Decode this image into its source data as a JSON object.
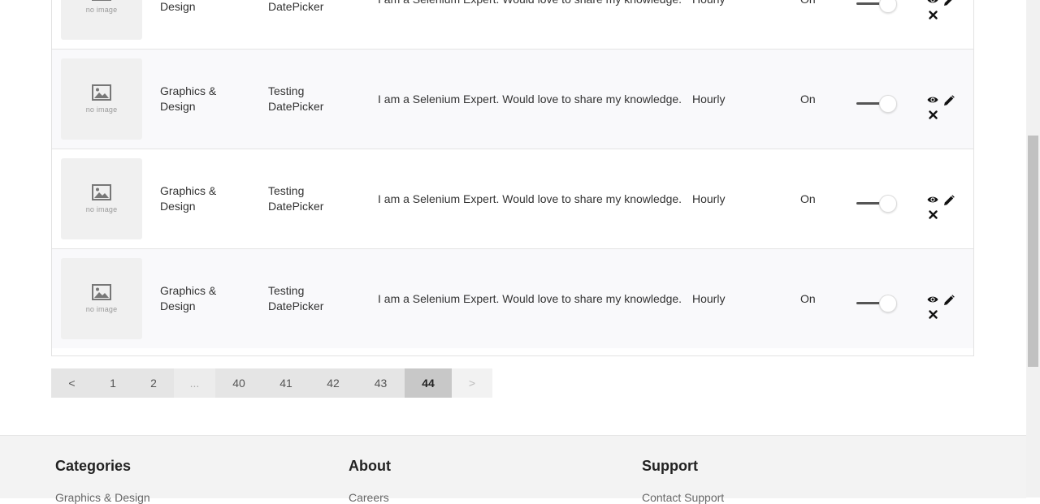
{
  "table": {
    "rows": [
      {
        "image_text": "no image",
        "category": "Graphics & Design",
        "title": "Testing DatePicker",
        "description": "I am a Selenium Expert. Would love to share my knowledge.",
        "type": "Hourly",
        "status": "On"
      },
      {
        "image_text": "no image",
        "category": "Graphics & Design",
        "title": "Testing DatePicker",
        "description": "I am a Selenium Expert. Would love to share my knowledge.",
        "type": "Hourly",
        "status": "On"
      },
      {
        "image_text": "no image",
        "category": "Graphics & Design",
        "title": "Testing DatePicker",
        "description": "I am a Selenium Expert. Would love to share my knowledge.",
        "type": "Hourly",
        "status": "On"
      },
      {
        "image_text": "no image",
        "category": "Graphics & Design",
        "title": "Testing DatePicker",
        "description": "I am a Selenium Expert. Would love to share my knowledge.",
        "type": "Hourly",
        "status": "On"
      }
    ],
    "action_icons": [
      "eye-icon",
      "pencil-icon",
      "close-icon"
    ]
  },
  "pagination": {
    "prev": "<",
    "pages": [
      "1",
      "2",
      "...",
      "40",
      "41",
      "42",
      "43",
      "44"
    ],
    "current": "44",
    "next": ">"
  },
  "footer": {
    "columns": [
      {
        "heading": "Categories",
        "first_link": "Graphics & Design"
      },
      {
        "heading": "About",
        "first_link": "Careers"
      },
      {
        "heading": "Support",
        "first_link": "Contact Support"
      }
    ]
  },
  "colors": {
    "active_page": "#c8c8c8",
    "page_bg": "#e5e5e5",
    "footer_bg": "#f3f3f3"
  }
}
